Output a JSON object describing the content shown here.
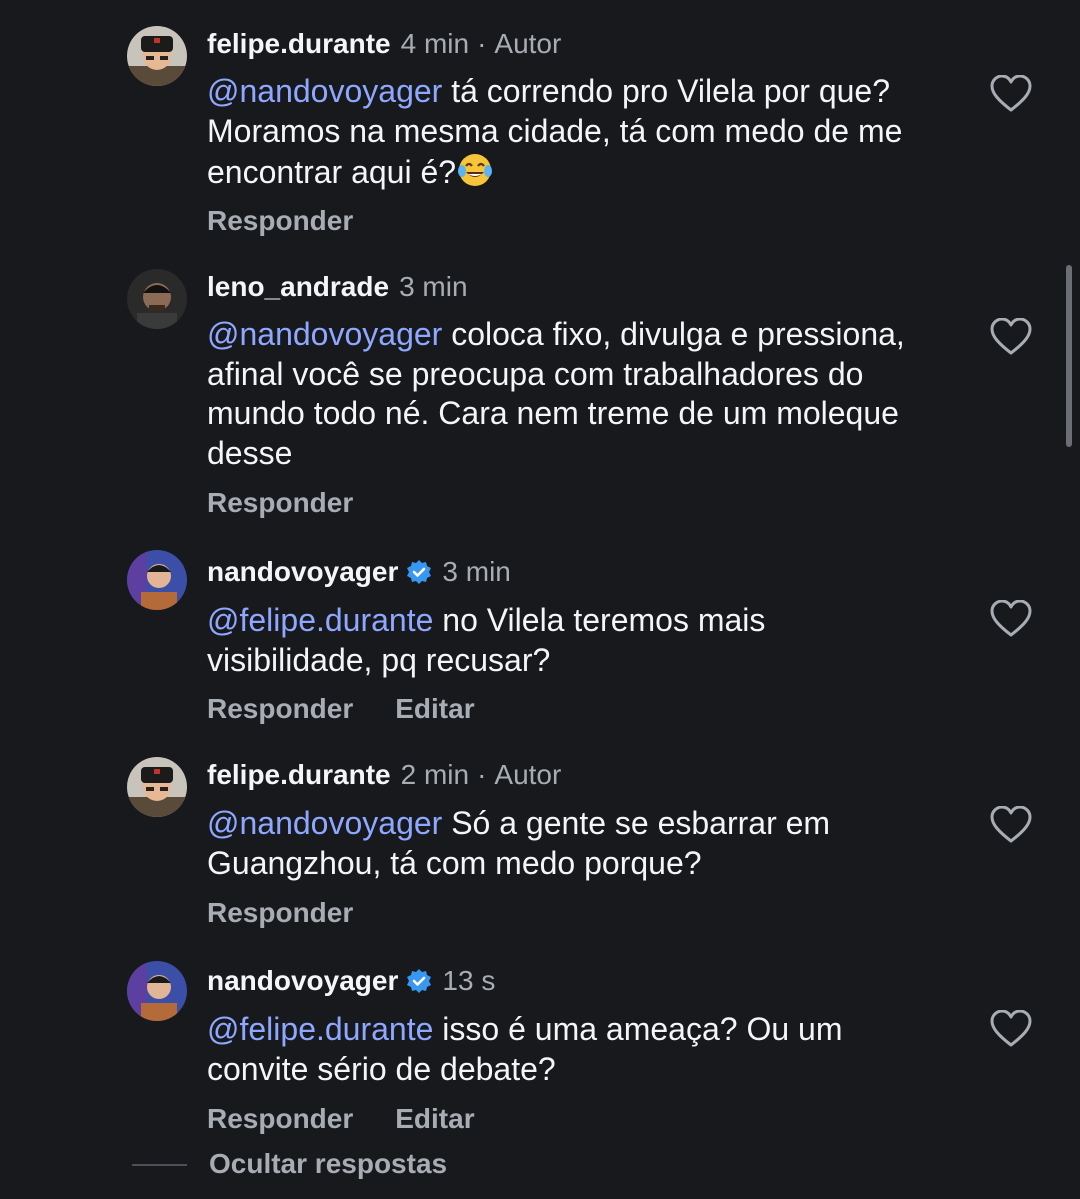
{
  "comments": [
    {
      "username": "felipe.durante",
      "time": "4 min",
      "author_tag": "Autor",
      "mention": "@nandovoyager",
      "text": " tá correndo pro Vilela por que? Moramos na mesma cidade, tá com medo de me encontrar aqui é?",
      "emoji": "face-with-tears-of-joy",
      "reply_label": "Responder"
    },
    {
      "username": "leno_andrade",
      "time": "3 min",
      "mention": "@nandovoyager",
      "text": " coloca fixo, divulga e pressiona, afinal você se preocupa com trabalhadores do mundo todo né. Cara nem treme de um moleque desse",
      "reply_label": "Responder"
    },
    {
      "username": "nandovoyager",
      "verified": true,
      "time": "3 min",
      "mention": "@felipe.durante",
      "text": " no Vilela teremos mais visibilidade, pq recusar?",
      "reply_label": "Responder",
      "edit_label": "Editar"
    },
    {
      "username": "felipe.durante",
      "time": "2 min",
      "author_tag": "Autor",
      "mention": "@nandovoyager",
      "text": " Só a gente se esbarrar em Guangzhou, tá com medo porque?",
      "reply_label": "Responder"
    },
    {
      "username": "nandovoyager",
      "verified": true,
      "time": "13 s",
      "mention": "@felipe.durante",
      "text": " isso é uma ameaça? Ou um convite sério de debate?",
      "reply_label": "Responder",
      "edit_label": "Editar"
    }
  ],
  "hide_replies_label": "Ocultar respostas",
  "colors": {
    "background": "#17191d",
    "text": "#f3f5f7",
    "secondary": "#a8acb3",
    "mention": "#8fa8ff",
    "verified": "#3897f0"
  },
  "icons": [
    "heart-outline-icon",
    "verified-badge-icon",
    "face-with-tears-of-joy-emoji"
  ]
}
